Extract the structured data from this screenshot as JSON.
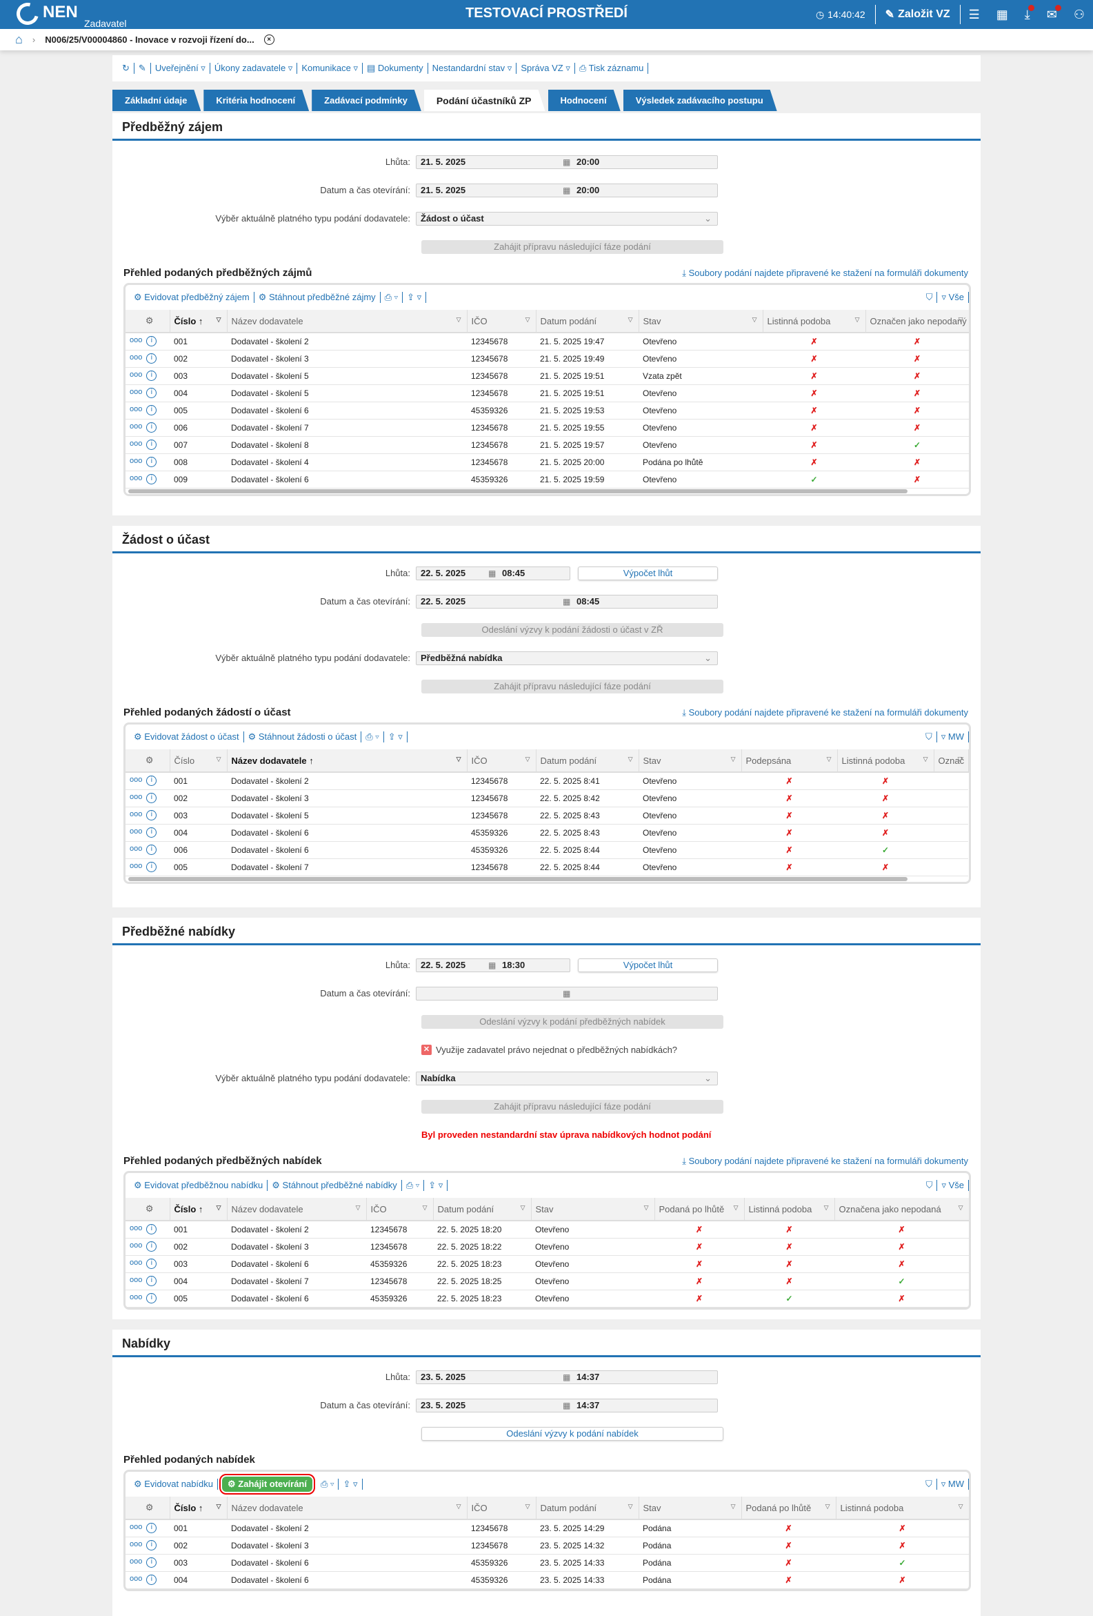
{
  "header": {
    "logo": "NEN",
    "logo_sub": "Zadavatel",
    "environment": "TESTOVACÍ PROSTŘEDÍ",
    "time": "14:40:42",
    "create_label": "Založit VZ"
  },
  "breadcrumb": {
    "title": "N006/25/V00004860 - Inovace v rozvoji řízení do..."
  },
  "toolbar": {
    "items": [
      "Uveřejnění ▿",
      "Úkony zadavatele ▿",
      "Komunikace ▿",
      "Dokumenty",
      "Nestandardní stav ▿",
      "Správa VZ ▿",
      "Tisk záznamu"
    ]
  },
  "tabs": [
    "Základní údaje",
    "Kritéria hodnocení",
    "Zadávací podmínky",
    "Podání účastníků ZP",
    "Hodnocení",
    "Výsledek zadávacího postupu"
  ],
  "colors": {
    "brand": "#2273b4",
    "no": "#e02020",
    "yes": "#3aaa35",
    "warning": "#ee0000"
  },
  "labels": {
    "lhuta": "Lhůta:",
    "datum": "Datum a čas otevírání:",
    "vyber": "Výběr aktuálně platného typu podání dodavatele:",
    "zahajit": "Zahájit přípravu následující fáze podání",
    "vypocet": "Výpočet lhůt",
    "soubory": "Soubory podání najdete připravené ke stažení na formuláři dokumenty"
  },
  "s1": {
    "title": "Předběžný zájem",
    "lhuta_date": "21. 5. 2025",
    "lhuta_time": "20:00",
    "otev_date": "21. 5. 2025",
    "otev_time": "20:00",
    "typ": "Žádost o účast",
    "list_title": "Přehled podaných předběžných zájmů",
    "table": {
      "tools": [
        "Evidovat předběžný zájem",
        "Stáhnout předběžné zájmy"
      ],
      "view": "Vše",
      "sort_col": 1,
      "columns": [
        "Číslo",
        "Název dodavatele",
        "IČO",
        "Datum podání",
        "Stav",
        "Listinná podoba",
        "Označen jako nepodaný"
      ],
      "rows": [
        [
          "001",
          "Dodavatel - školení 2",
          "12345678",
          "21. 5. 2025 19:47",
          "Otevřeno",
          "no",
          "no"
        ],
        [
          "002",
          "Dodavatel - školení 3",
          "12345678",
          "21. 5. 2025 19:49",
          "Otevřeno",
          "no",
          "no"
        ],
        [
          "003",
          "Dodavatel - školení 5",
          "12345678",
          "21. 5. 2025 19:51",
          "Vzata zpět",
          "no",
          "no"
        ],
        [
          "004",
          "Dodavatel - školení 5",
          "12345678",
          "21. 5. 2025 19:51",
          "Otevřeno",
          "no",
          "no"
        ],
        [
          "005",
          "Dodavatel - školení 6",
          "45359326",
          "21. 5. 2025 19:53",
          "Otevřeno",
          "no",
          "no"
        ],
        [
          "006",
          "Dodavatel - školení 7",
          "12345678",
          "21. 5. 2025 19:55",
          "Otevřeno",
          "no",
          "no"
        ],
        [
          "007",
          "Dodavatel - školení 8",
          "12345678",
          "21. 5. 2025 19:57",
          "Otevřeno",
          "no",
          "yes"
        ],
        [
          "008",
          "Dodavatel - školení 4",
          "12345678",
          "21. 5. 2025 20:00",
          "Podána po lhůtě",
          "no",
          "no"
        ],
        [
          "009",
          "Dodavatel - školení 6",
          "45359326",
          "21. 5. 2025 19:59",
          "Otevřeno",
          "yes",
          "no"
        ]
      ]
    }
  },
  "s2": {
    "title": "Žádost o účast",
    "lhuta_date": "22. 5. 2025",
    "lhuta_time": "08:45",
    "otev_date": "22. 5. 2025",
    "otev_time": "08:45",
    "odeslani": "Odeslání výzvy k podání žádosti o účast v ZŘ",
    "typ": "Předběžná nabídka",
    "list_title": "Přehled podaných žádostí o účast",
    "table": {
      "tools": [
        "Evidovat žádost o účast",
        "Stáhnout žádosti o účast"
      ],
      "view": "MW",
      "sort_col": 2,
      "columns": [
        "Číslo",
        "Název dodavatele",
        "IČO",
        "Datum podání",
        "Stav",
        "Podepsána",
        "Listinná podoba",
        "Označ"
      ],
      "rows": [
        [
          "001",
          "Dodavatel - školení 2",
          "12345678",
          "22. 5. 2025 8:41",
          "Otevřeno",
          "no",
          "no",
          ""
        ],
        [
          "002",
          "Dodavatel - školení 3",
          "12345678",
          "22. 5. 2025 8:42",
          "Otevřeno",
          "no",
          "no",
          ""
        ],
        [
          "003",
          "Dodavatel - školení 5",
          "12345678",
          "22. 5. 2025 8:43",
          "Otevřeno",
          "no",
          "no",
          ""
        ],
        [
          "004",
          "Dodavatel - školení 6",
          "45359326",
          "22. 5. 2025 8:43",
          "Otevřeno",
          "no",
          "no",
          ""
        ],
        [
          "006",
          "Dodavatel - školení 6",
          "45359326",
          "22. 5. 2025 8:44",
          "Otevřeno",
          "no",
          "yes",
          ""
        ],
        [
          "005",
          "Dodavatel - školení 7",
          "12345678",
          "22. 5. 2025 8:44",
          "Otevřeno",
          "no",
          "no",
          ""
        ]
      ]
    }
  },
  "s3": {
    "title": "Předběžné nabídky",
    "lhuta_date": "22. 5. 2025",
    "lhuta_time": "18:30",
    "odeslani": "Odeslání výzvy k podání předběžných nabídek",
    "question": "Využije zadavatel právo nejednat o předběžných nabídkách?",
    "typ": "Nabídka",
    "warning": "Byl proveden nestandardní stav úprava nabídkových hodnot podání",
    "list_title": "Přehled podaných předběžných nabídek",
    "table": {
      "tools": [
        "Evidovat předběžnou nabídku",
        "Stáhnout předběžné nabídky"
      ],
      "view": "Vše",
      "sort_col": 1,
      "columns": [
        "Číslo",
        "Název dodavatele",
        "IČO",
        "Datum podání",
        "Stav",
        "Podaná po lhůtě",
        "Listinná podoba",
        "Označena jako nepodaná"
      ],
      "rows": [
        [
          "001",
          "Dodavatel - školení 2",
          "12345678",
          "22. 5. 2025 18:20",
          "Otevřeno",
          "no",
          "no",
          "no"
        ],
        [
          "002",
          "Dodavatel - školení 3",
          "12345678",
          "22. 5. 2025 18:22",
          "Otevřeno",
          "no",
          "no",
          "no"
        ],
        [
          "003",
          "Dodavatel - školení 6",
          "45359326",
          "22. 5. 2025 18:23",
          "Otevřeno",
          "no",
          "no",
          "no"
        ],
        [
          "004",
          "Dodavatel - školení 7",
          "12345678",
          "22. 5. 2025 18:25",
          "Otevřeno",
          "no",
          "no",
          "yes"
        ],
        [
          "005",
          "Dodavatel - školení 6",
          "45359326",
          "22. 5. 2025 18:23",
          "Otevřeno",
          "no",
          "yes",
          "no"
        ]
      ]
    }
  },
  "s4": {
    "title": "Nabídky",
    "lhuta_date": "23. 5. 2025",
    "lhuta_time": "14:37",
    "otev_date": "23. 5. 2025",
    "otev_time": "14:37",
    "odeslani": "Odeslání výzvy k podání nabídek",
    "list_title": "Přehled podaných nabídek",
    "table": {
      "tools": [
        "Evidovat nabídku",
        "Zahájit otevírání"
      ],
      "view": "MW",
      "sort_col": 1,
      "columns": [
        "Číslo",
        "Název dodavatele",
        "IČO",
        "Datum podání",
        "Stav",
        "Podaná po lhůtě",
        "Listinná podoba"
      ],
      "rows": [
        [
          "001",
          "Dodavatel - školení 2",
          "12345678",
          "23. 5. 2025 14:29",
          "Podána",
          "no",
          "no"
        ],
        [
          "002",
          "Dodavatel - školení 3",
          "12345678",
          "23. 5. 2025 14:32",
          "Podána",
          "no",
          "no"
        ],
        [
          "003",
          "Dodavatel - školení 6",
          "45359326",
          "23. 5. 2025 14:33",
          "Podána",
          "no",
          "yes"
        ],
        [
          "004",
          "Dodavatel - školení 6",
          "45359326",
          "23. 5. 2025 14:33",
          "Podána",
          "no",
          "no"
        ]
      ]
    }
  }
}
